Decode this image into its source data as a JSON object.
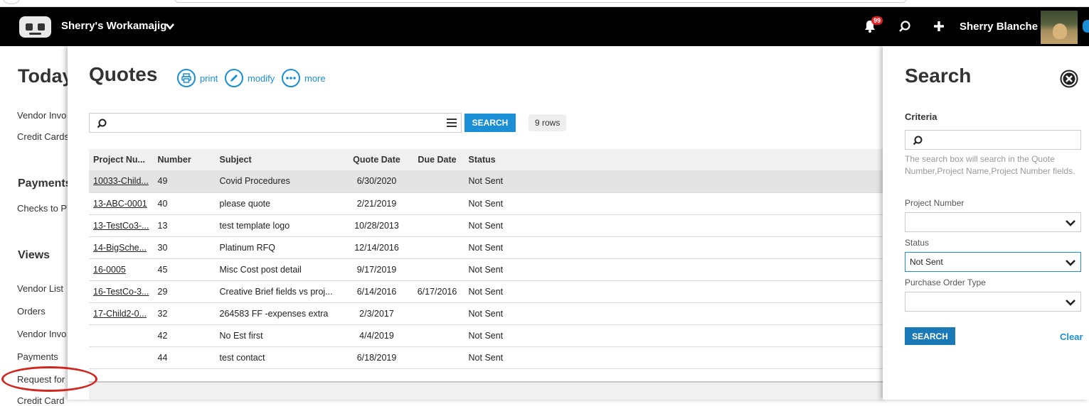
{
  "topbar": {
    "app_name": "Sherry's Workamajig",
    "notifications_count": "99",
    "user_name": "Sherry Blanche"
  },
  "left_page": {
    "heading_today": "Today",
    "item_vendor_invoices_1": "Vendor Invo",
    "item_credit_cards": "Credit Cards",
    "heading_payments": "Payments",
    "item_checks": "Checks to Pr",
    "heading_views": "Views",
    "item_vendor_list": "Vendor List",
    "item_orders": "Orders",
    "item_vendor_invoices_2": "Vendor Invo",
    "item_payments": "Payments",
    "item_request_for": "Request for",
    "item_credit_partial": "Credit Card"
  },
  "main": {
    "title": "Quotes",
    "actions": {
      "print": "print",
      "modify": "modify",
      "more": "more"
    },
    "search_button": "SEARCH",
    "rows_count": "9 rows",
    "columns": [
      "Project Nu...",
      "Number",
      "Subject",
      "Quote Date",
      "Due Date",
      "Status"
    ],
    "rows": [
      {
        "project": "10033-Child...",
        "number": "49",
        "subject": "Covid Procedures",
        "quote_date": "6/30/2020",
        "due_date": "",
        "status": "Not Sent"
      },
      {
        "project": "13-ABC-0001",
        "number": "40",
        "subject": "please quote",
        "quote_date": "2/21/2019",
        "due_date": "",
        "status": "Not Sent"
      },
      {
        "project": "13-TestCo3-...",
        "number": "13",
        "subject": "test template logo",
        "quote_date": "10/28/2013",
        "due_date": "",
        "status": "Not Sent"
      },
      {
        "project": "14-BigSche...",
        "number": "30",
        "subject": "Platinum RFQ",
        "quote_date": "12/14/2016",
        "due_date": "",
        "status": "Not Sent"
      },
      {
        "project": "16-0005",
        "number": "45",
        "subject": "Misc Cost post detail",
        "quote_date": "9/17/2019",
        "due_date": "",
        "status": "Not Sent"
      },
      {
        "project": "16-TestCo-3...",
        "number": "29",
        "subject": "Creative Brief fields vs proj...",
        "quote_date": "6/14/2016",
        "due_date": "6/17/2016",
        "status": "Not Sent"
      },
      {
        "project": "17-Child2-0...",
        "number": "32",
        "subject": "264583 FF -expenses extra",
        "quote_date": "2/3/2017",
        "due_date": "",
        "status": "Not Sent"
      },
      {
        "project": "",
        "number": "42",
        "subject": "No Est first",
        "quote_date": "4/4/2019",
        "due_date": "",
        "status": "Not Sent"
      },
      {
        "project": "",
        "number": "44",
        "subject": "test contact",
        "quote_date": "6/18/2019",
        "due_date": "",
        "status": "Not Sent"
      }
    ]
  },
  "search_panel": {
    "title": "Search",
    "criteria_label": "Criteria",
    "help_text": "The search box will search in the Quote Number,Project Name,Project Number fields.",
    "project_number_label": "Project Number",
    "project_number_value": "",
    "status_label": "Status",
    "status_value": "Not Sent",
    "po_type_label": "Purchase Order Type",
    "po_type_value": "",
    "search_button": "SEARCH",
    "clear_label": "Clear"
  },
  "colors": {
    "accent": "#1a8fd6",
    "topbar": "#000000",
    "badge": "#e02020",
    "annotation_oval": "#d0261e"
  }
}
